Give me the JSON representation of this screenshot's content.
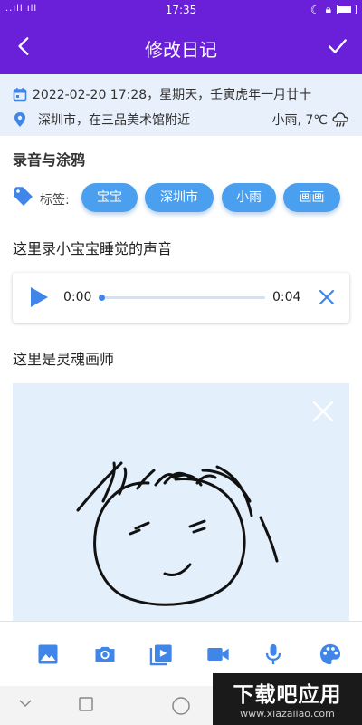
{
  "status_bar": {
    "signal": "..ıll ıll",
    "time": "17:35"
  },
  "app_bar": {
    "title": "修改日记"
  },
  "info": {
    "datetime": "2022-02-20 17:28，星期天，壬寅虎年一月廿十",
    "location": "深圳市，在三品美术馆附近",
    "weather": "小雨, 7℃"
  },
  "section_title": "录音与涂鸦",
  "tags": {
    "label": "标签:",
    "items": [
      "宝宝",
      "深圳市",
      "小雨",
      "画画"
    ]
  },
  "paragraph_audio": "这里录小宝宝睡觉的声音",
  "audio": {
    "current": "0:00",
    "duration": "0:04",
    "progress": 0
  },
  "paragraph_drawing": "这里是灵魂画师",
  "toolbar": {
    "icons": [
      "image-icon",
      "camera-icon",
      "video-library-icon",
      "videocam-icon",
      "mic-icon",
      "palette-icon"
    ]
  },
  "colors": {
    "primary": "#6a1fd8",
    "accent": "#4a9fef",
    "info_bg": "#e8f0fb",
    "drawing_bg": "#e3effb"
  },
  "watermark": {
    "main": "下载吧应用",
    "sub": "www.xiazaiiao.com"
  }
}
